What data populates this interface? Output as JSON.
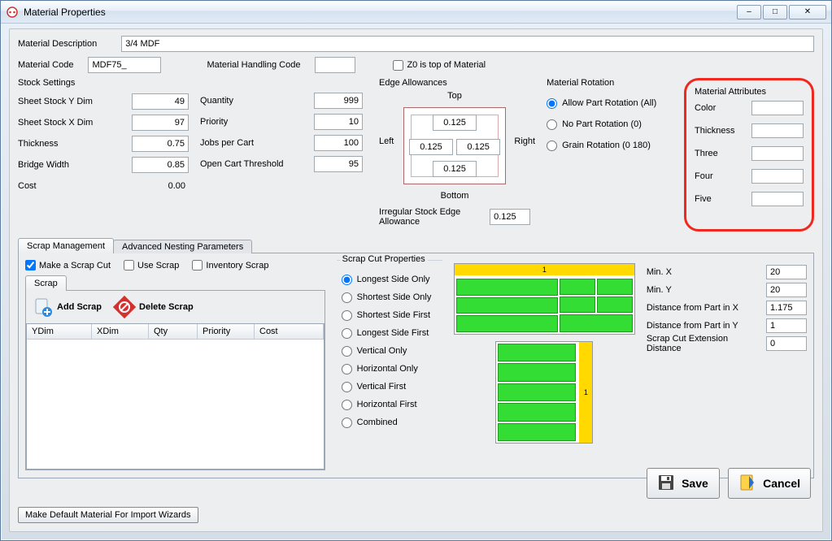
{
  "window": {
    "title": "Material Properties"
  },
  "labels": {
    "materialDescription": "Material Description",
    "materialCode": "Material Code",
    "materialHandlingCode": "Material Handling Code",
    "z0TopMaterial": "Z0 is top of Material",
    "stockSettings": "Stock Settings",
    "sheetYDim": "Sheet Stock Y Dim",
    "sheetXDim": "Sheet Stock X Dim",
    "thickness": "Thickness",
    "bridgeWidth": "Bridge Width",
    "cost": "Cost",
    "quantity": "Quantity",
    "priority": "Priority",
    "jobsPerCart": "Jobs per Cart",
    "openCartThreshold": "Open Cart Threshold",
    "edgeAllowances": "Edge Allowances",
    "irregularStockEdge": "Irregular Stock Edge Allowance",
    "top": "Top",
    "bottom": "Bottom",
    "left": "Left",
    "right": "Right",
    "materialRotation": "Material Rotation",
    "allowPartRotation": "Allow Part Rotation (All)",
    "noPartRotation": "No Part Rotation (0)",
    "grainRotation": "Grain Rotation (0 180)",
    "materialAttributes": "Material Attributes",
    "color": "Color",
    "thicknessAttr": "Thickness",
    "three": "Three",
    "four": "Four",
    "five": "Five",
    "tabScrap": "Scrap Management",
    "tabAdvanced": "Advanced Nesting Parameters",
    "makeScrapCut": "Make a Scrap Cut",
    "useScrap": "Use Scrap",
    "inventoryScrap": "Inventory Scrap",
    "scrapSubTab": "Scrap",
    "addScrap": "Add Scrap",
    "deleteScrap": "Delete Scrap",
    "ydim": "YDim",
    "xdim": "XDim",
    "qtyCol": "Qty",
    "priorityCol": "Priority",
    "costCol": "Cost",
    "scrapCutProps": "Scrap Cut Properties",
    "longestSideOnly": "Longest Side Only",
    "shortestSideOnly": "Shortest Side Only",
    "shortestSideFirst": "Shortest Side First",
    "longestSideFirst": "Longest Side First",
    "verticalOnly": "Vertical Only",
    "horizontalOnly": "Horizontal Only",
    "verticalFirst": "Vertical First",
    "horizontalFirst": "Horizontal First",
    "combined": "Combined",
    "minX": "Min. X",
    "minY": "Min. Y",
    "distFromPartX": "Distance from Part in X",
    "distFromPartY": "Distance from Part in Y",
    "scrapCutExt": "Scrap Cut Extension Distance",
    "save": "Save",
    "cancel": "Cancel",
    "makeDefault": "Make Default Material For Import Wizards"
  },
  "values": {
    "materialDescription": "3/4 MDF",
    "materialCode": "MDF75_",
    "materialHandlingCode": "",
    "sheetYDim": "49",
    "sheetXDim": "97",
    "thickness": "0.75",
    "bridgeWidth": "0.85",
    "cost": "0.00",
    "quantity": "999",
    "priority": "10",
    "jobsPerCart": "100",
    "openCartThreshold": "95",
    "edgeTop": "0.125",
    "edgeLeft": "0.125",
    "edgeRight": "0.125",
    "edgeBottom": "0.125",
    "irregular": "0.125",
    "minX": "20",
    "minY": "20",
    "distX": "1.175",
    "distY": "1",
    "scrapExt": "0",
    "diagLabel1": "1",
    "diagLabel2": "1"
  }
}
